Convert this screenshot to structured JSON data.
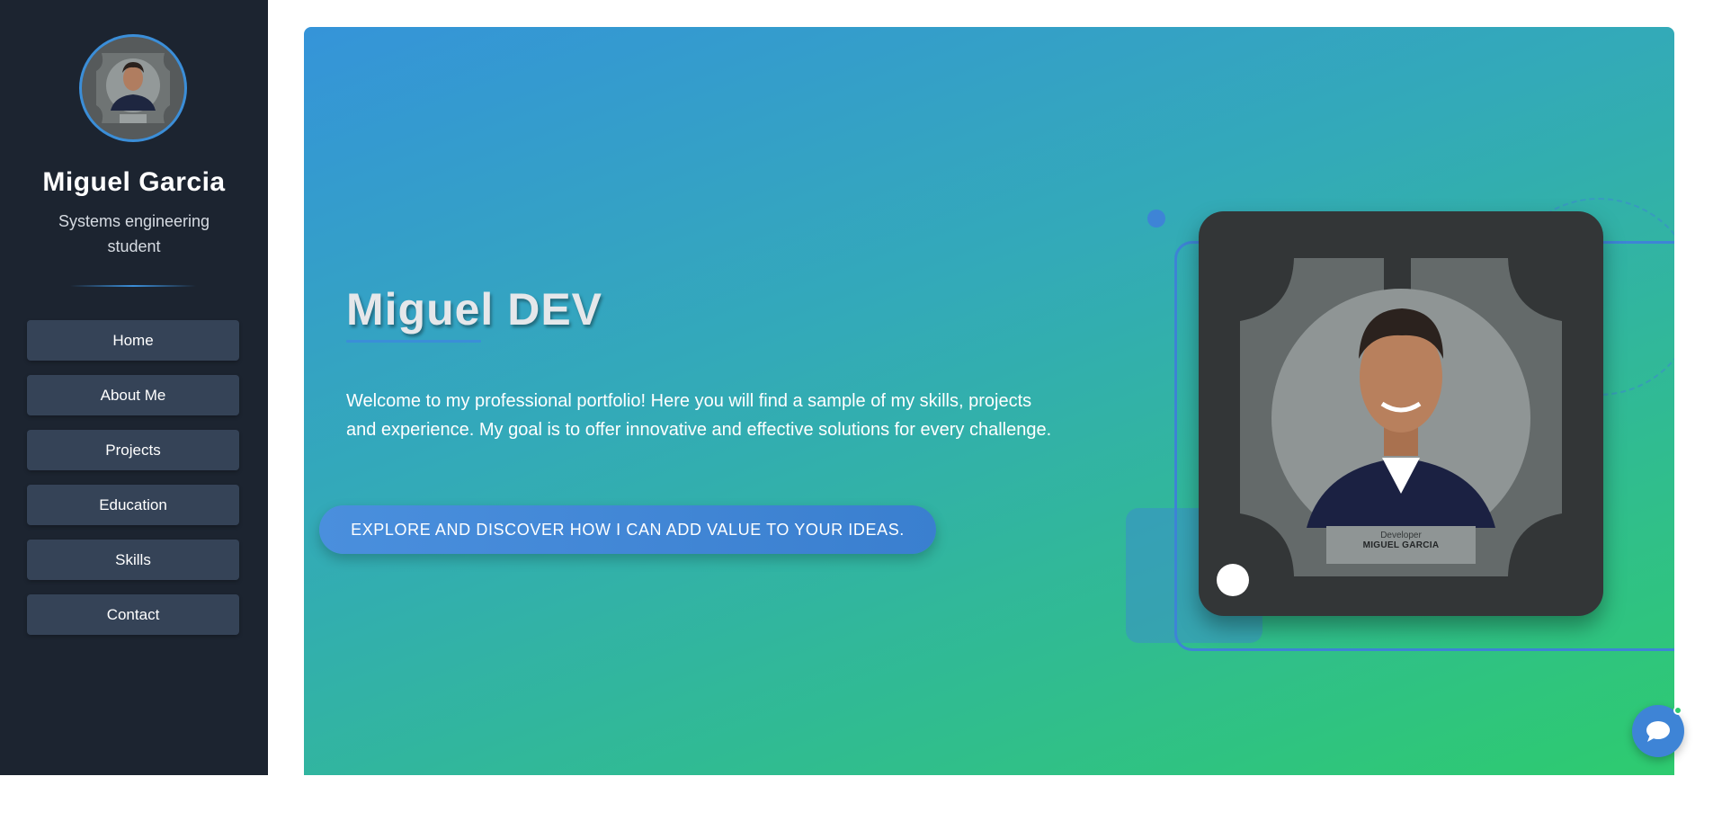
{
  "sidebar": {
    "name": "Miguel Garcia",
    "role": "Systems engineering student",
    "nav_items": [
      {
        "label": "Home"
      },
      {
        "label": "About Me"
      },
      {
        "label": "Projects"
      },
      {
        "label": "Education"
      },
      {
        "label": "Skills"
      },
      {
        "label": "Contact"
      }
    ]
  },
  "hero": {
    "title": "Miguel DEV",
    "description": "Welcome to my professional portfolio! Here you will find a sample of my skills, projects and experience. My goal is to offer innovative and effective solutions for every challenge.",
    "cta_label": "EXPLORE AND DISCOVER HOW I CAN ADD VALUE TO YOUR IDEAS.",
    "photo_badge": {
      "role": "Developer",
      "name": "MIGUEL GARCIA"
    }
  },
  "colors": {
    "sidebar_bg": "#1c2430",
    "nav_item_bg": "#354357",
    "accent": "#3b8ed8",
    "gradient_start": "#3594d9",
    "gradient_end": "#2ecb6f",
    "card_bg": "#333637",
    "online_status": "#2ecb6f"
  },
  "icons": {
    "chat": "chat-bubble-icon"
  }
}
